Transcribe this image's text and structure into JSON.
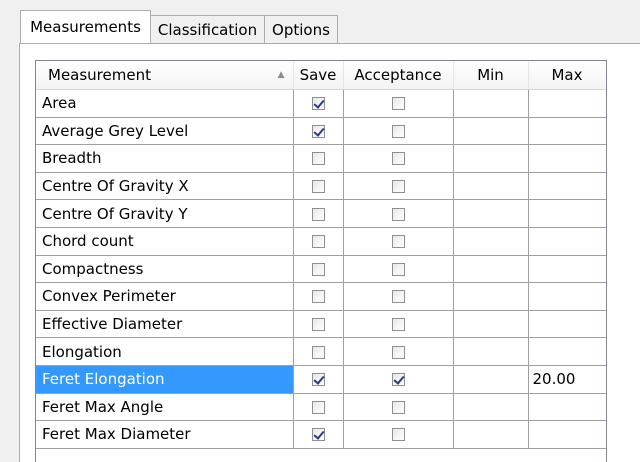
{
  "tabs": [
    {
      "label": "Measurements",
      "active": true
    },
    {
      "label": "Classification",
      "active": false
    },
    {
      "label": "Options",
      "active": false
    }
  ],
  "grid": {
    "columns": {
      "measurement": "Measurement",
      "save": "Save",
      "acceptance": "Acceptance",
      "min": "Min",
      "max": "Max"
    },
    "sort_indicator": "ascending",
    "rows": [
      {
        "name": "Area",
        "save": true,
        "acceptance": false,
        "min": "",
        "max": ""
      },
      {
        "name": "Average Grey Level",
        "save": true,
        "acceptance": false,
        "min": "",
        "max": ""
      },
      {
        "name": "Breadth",
        "save": false,
        "acceptance": false,
        "min": "",
        "max": ""
      },
      {
        "name": "Centre Of Gravity X",
        "save": false,
        "acceptance": false,
        "min": "",
        "max": ""
      },
      {
        "name": "Centre Of Gravity Y",
        "save": false,
        "acceptance": false,
        "min": "",
        "max": ""
      },
      {
        "name": "Chord count",
        "save": false,
        "acceptance": false,
        "min": "",
        "max": ""
      },
      {
        "name": "Compactness",
        "save": false,
        "acceptance": false,
        "min": "",
        "max": ""
      },
      {
        "name": "Convex Perimeter",
        "save": false,
        "acceptance": false,
        "min": "",
        "max": ""
      },
      {
        "name": "Effective Diameter",
        "save": false,
        "acceptance": false,
        "min": "",
        "max": ""
      },
      {
        "name": "Elongation",
        "save": false,
        "acceptance": false,
        "min": "",
        "max": ""
      },
      {
        "name": "Feret Elongation",
        "save": true,
        "acceptance": true,
        "min": "",
        "max": "20.00",
        "selected": true
      },
      {
        "name": "Feret Max Angle",
        "save": false,
        "acceptance": false,
        "min": "",
        "max": ""
      },
      {
        "name": "Feret Max Diameter",
        "save": true,
        "acceptance": false,
        "min": "",
        "max": ""
      }
    ]
  },
  "colors": {
    "selection": "#3399ff",
    "check": "#2a3a84",
    "gridline": "#a0a0a0"
  }
}
